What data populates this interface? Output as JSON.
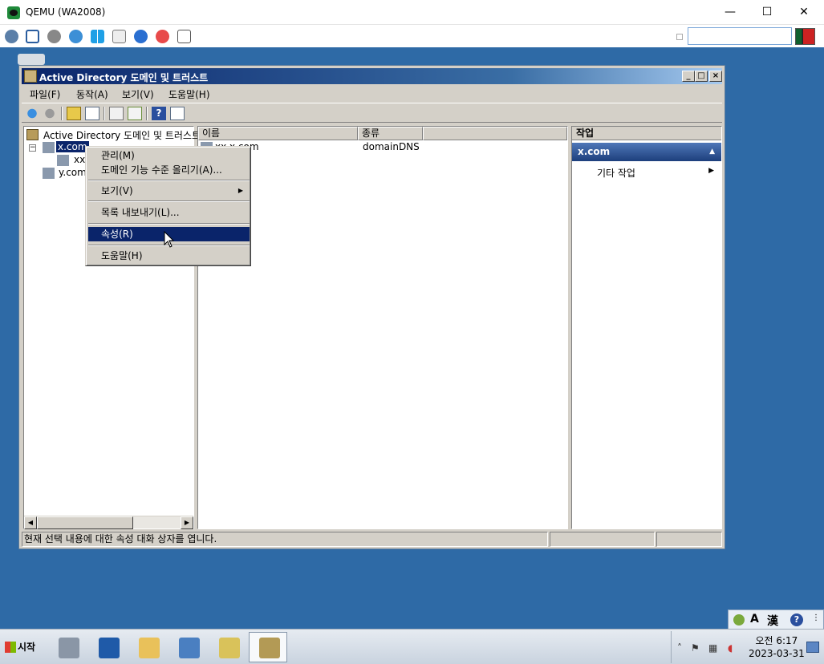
{
  "qemu": {
    "title": "QEMU (WA2008)",
    "minimize": "—",
    "maximize": "☐",
    "close": "✕",
    "toolbar_icons": [
      "network-icon",
      "fullscreen-icon",
      "settings-icon",
      "refresh-icon",
      "windows-icon",
      "usb-icon",
      "info-icon",
      "stop-icon",
      "screenshot-icon"
    ]
  },
  "adwindow": {
    "title": "Active Directory 도메인 및 트러스트",
    "controls": {
      "minimize": "_",
      "maximize": "□",
      "close": "×"
    },
    "menu": [
      "파일(F)",
      "동작(A)",
      "보기(V)",
      "도움말(H)"
    ],
    "tree": {
      "root": "Active Directory 도메인 및 트러스트",
      "items": [
        "x.com",
        "xx",
        "y.com"
      ],
      "expander": "−"
    },
    "list": {
      "columns": [
        "이름",
        "종류"
      ],
      "rows": [
        {
          "name": "xx.x.com",
          "type": "domainDNS"
        }
      ]
    },
    "actions": {
      "header": "작업",
      "section": "x.com",
      "section_arrow": "▲",
      "items": [
        "기타 작업"
      ],
      "item_arrow": "▶"
    },
    "status": "현재 선택 내용에 대한 속성 대화 상자를 엽니다."
  },
  "context_menu": {
    "items": [
      {
        "label": "관리(M)"
      },
      {
        "label": "도메인 기능 수준 올리기(A)..."
      },
      {
        "label": "보기(V)",
        "submenu": "▶"
      },
      {
        "label": "목록 내보내기(L)..."
      },
      {
        "label": "속성(R)",
        "highlighted": true
      },
      {
        "label": "도움말(H)"
      }
    ]
  },
  "langbar": {
    "mode": "A",
    "hanja": "漢",
    "help": "?"
  },
  "taskbar": {
    "start": "시작",
    "apps": [
      "server-manager-icon",
      "powershell-icon",
      "explorer-icon",
      "control-panel-icon",
      "ad-tools-icon",
      "ad-domains-trusts-icon"
    ],
    "clock_time": "오전 6:17",
    "clock_date": "2023-03-31"
  },
  "colors": {
    "desktop": "#2e6aa6",
    "menu_highlight": "#0a246a",
    "title_gradient_start": "#0a246a"
  }
}
